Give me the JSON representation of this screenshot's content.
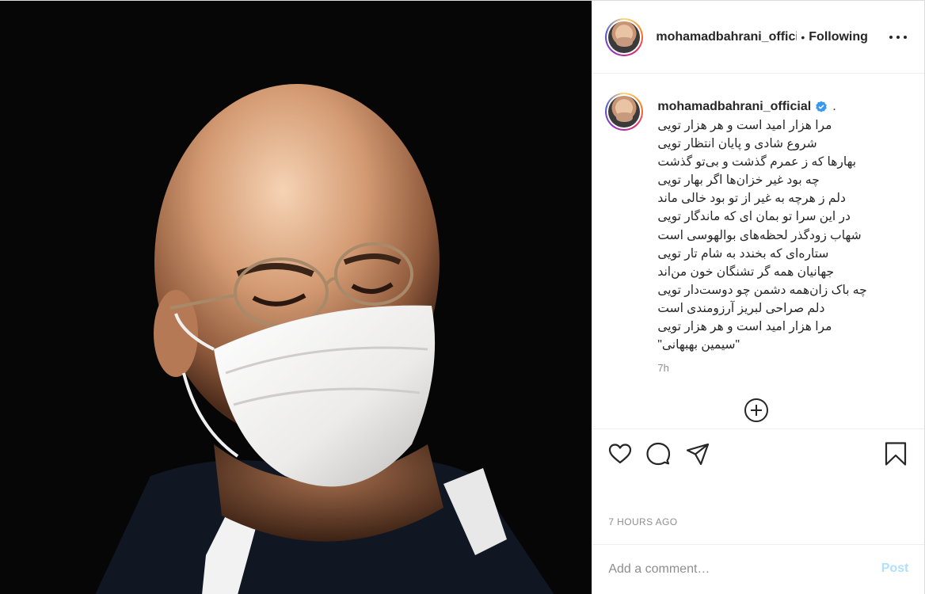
{
  "photo": {
    "alt": ""
  },
  "header": {
    "username": "mohamadbahrani_official",
    "separator": "•",
    "follow_status": "Following",
    "more_icon": "more-horizontal-icon"
  },
  "caption": {
    "username": "mohamadbahrani_official",
    "trailing": ".",
    "lines": [
      "مرا هزار امید است و هر هزار تویی",
      "شروع شادی و پایان انتظار تویی",
      "بهارها که ز عمرم گذشت و بی‌تو گذشت",
      "چه بود غیر خزان‌ها اگر بهار تویی",
      "دلم ز هرچه به غیر از تو  بود خالی ماند",
      "در این سرا تو بمان ای که ماندگار تویی",
      "شهاب زودگذر لحظه‌های بوالهوسی است",
      "ستاره‌ای که بخندد به شام تار تویی",
      "جهانیان همه گر تشنگان خون من‌اند",
      "چه باک زان‌همه دشمن چو دوست‌دار تویی",
      "دلم صراحی لبریز آرزومندی است",
      "مرا هزار امید است و هر هزار تویی",
      "\"سیمین بهبهانی\""
    ],
    "time": "7h"
  },
  "actions": {
    "like_icon": "heart-icon",
    "comment_icon": "comment-icon",
    "share_icon": "paper-plane-icon",
    "save_icon": "bookmark-icon"
  },
  "timestamp": "7 HOURS AGO",
  "comment": {
    "placeholder": "Add a comment…",
    "post_label": "Post"
  },
  "colors": {
    "verified": "#3897f0",
    "post_disabled": "#b2dffc",
    "muted": "#8e8e8e"
  }
}
